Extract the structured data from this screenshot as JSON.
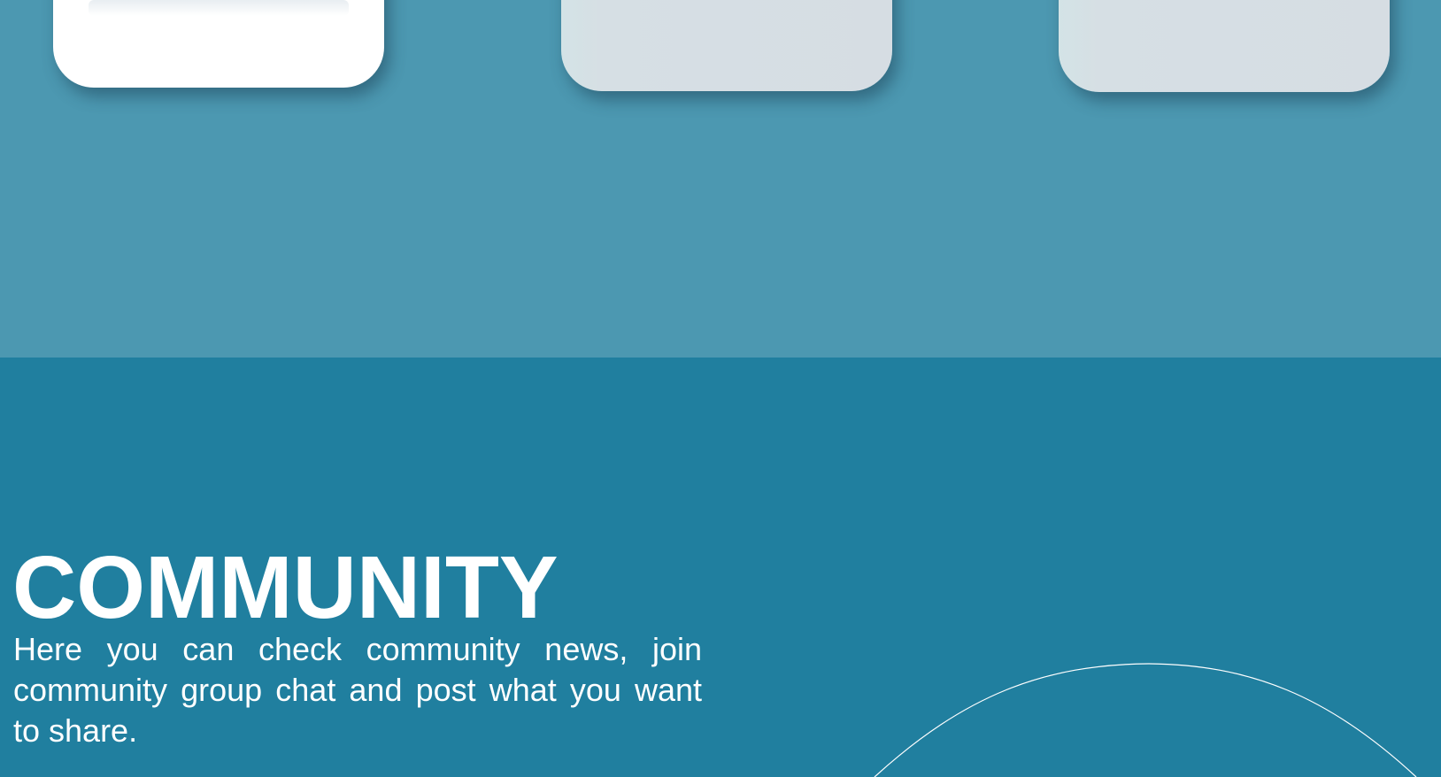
{
  "section": {
    "title": "COMMUNITY",
    "description": "Here you can check community news, join community group chat and post what you want to share."
  },
  "colors": {
    "top_band": "#4c98b1",
    "bottom_band": "#207f9f",
    "card_primary": "#ffffff",
    "card_secondary": "#d6dde3",
    "text": "#ffffff"
  }
}
